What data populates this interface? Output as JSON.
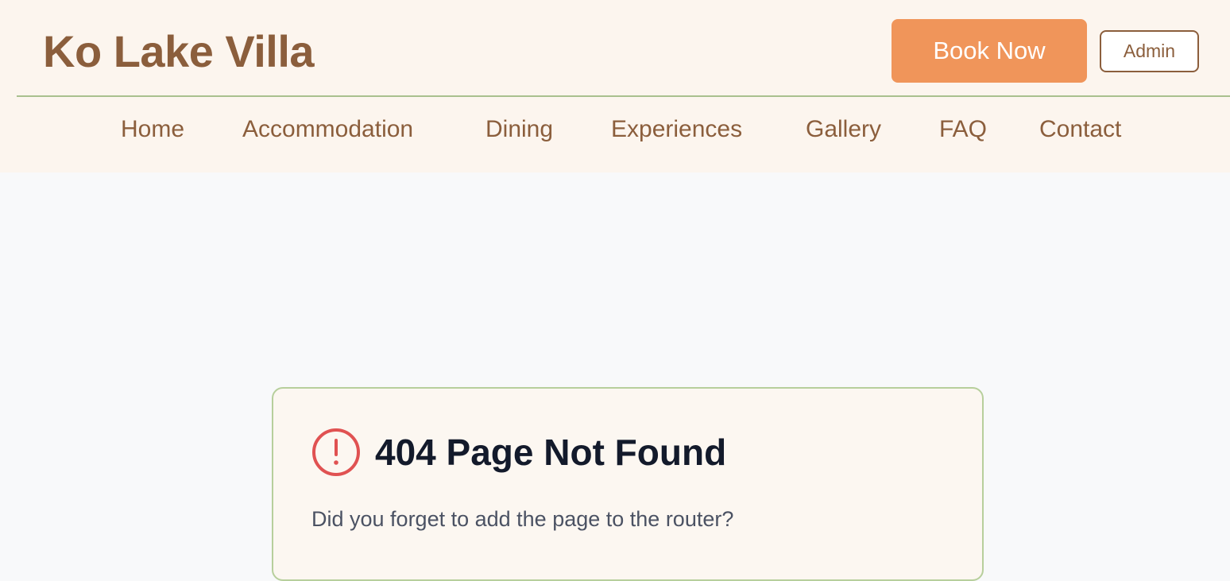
{
  "header": {
    "brand": "Ko Lake Villa",
    "book_label": "Book Now",
    "admin_label": "Admin"
  },
  "nav": {
    "items": [
      {
        "label": "Home"
      },
      {
        "label": "Accommodation"
      },
      {
        "label": "Dining"
      },
      {
        "label": "Experiences"
      },
      {
        "label": "Gallery"
      },
      {
        "label": "FAQ"
      },
      {
        "label": "Contact"
      }
    ]
  },
  "error_card": {
    "icon": "alert-circle-icon",
    "title": "404 Page Not Found",
    "message": "Did you forget to add the page to the router?"
  },
  "colors": {
    "brand": "#8b5e3c",
    "accent": "#f0955a",
    "border_green": "#a9c08e",
    "error_red": "#e05252"
  }
}
